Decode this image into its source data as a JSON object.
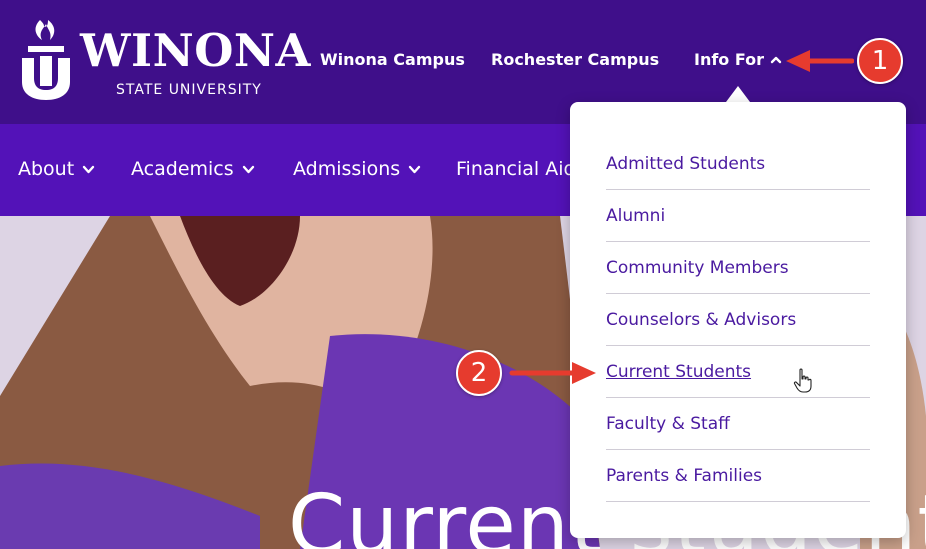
{
  "header": {
    "logo": {
      "word": "WINONA",
      "subtitle": "STATE UNIVERSITY"
    },
    "links": {
      "winona_campus": "Winona Campus",
      "rochester_campus": "Rochester Campus",
      "info_for": "Info For"
    }
  },
  "nav": {
    "about": "About",
    "academics": "Academics",
    "admissions": "Admissions",
    "financial_aid": "Financial Aid"
  },
  "dropdown": {
    "items": [
      "Admitted Students",
      "Alumni",
      "Community Members",
      "Counselors & Advisors",
      "Current Students",
      "Faculty & Staff",
      "Parents & Families"
    ]
  },
  "hero": {
    "title": "Current students"
  },
  "annotations": {
    "step1": "1",
    "step2": "2"
  },
  "colors": {
    "header_bg": "#3f0f8a",
    "nav_bg": "#5312b8",
    "link_color": "#4a1aa0",
    "annotation_red": "#e63b2e"
  }
}
